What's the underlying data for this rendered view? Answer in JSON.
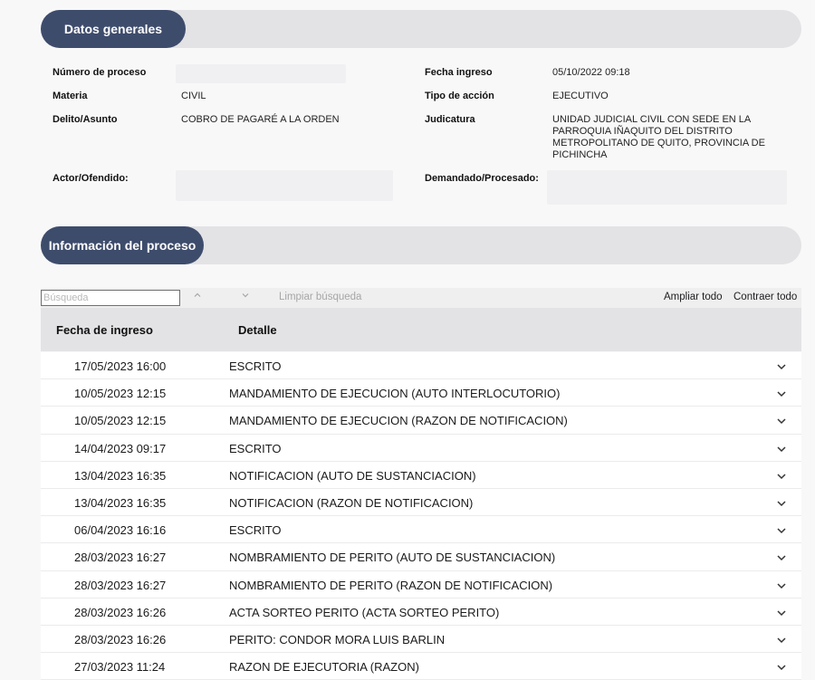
{
  "general": {
    "title": "Datos generales",
    "numero_proceso": {
      "label": "Número de proceso",
      "value": ""
    },
    "fecha_ingreso": {
      "label": "Fecha ingreso",
      "value": "05/10/2022 09:18"
    },
    "materia": {
      "label": "Materia",
      "value": "CIVIL"
    },
    "tipo_accion": {
      "label": "Tipo de acción",
      "value": "EJECUTIVO"
    },
    "delito": {
      "label": "Delito/Asunto",
      "value": "COBRO DE PAGARÉ A LA ORDEN"
    },
    "judicatura": {
      "label": "Judicatura",
      "value_lines": [
        "UNIDAD JUDICIAL CIVIL CON SEDE EN LA",
        "PARROQUIA IÑAQUITO DEL DISTRITO",
        "METROPOLITANO DE QUITO, PROVINCIA DE",
        "PICHINCHA"
      ]
    },
    "actor": {
      "label": "Actor/Ofendido:",
      "value": ""
    },
    "demandado": {
      "label": "Demandado/Procesado:",
      "value": ""
    }
  },
  "process": {
    "title": "Información del proceso",
    "search": {
      "placeholder": "Búsqueda",
      "value": ""
    },
    "toolbar": {
      "clear_label": "Limpiar búsqueda",
      "expand_all_label": "Ampliar todo",
      "collapse_all_label": "Contraer todo"
    },
    "columns": {
      "date": "Fecha de ingreso",
      "detail": "Detalle"
    },
    "rows": [
      {
        "date": "17/05/2023 16:00",
        "detail": "ESCRITO"
      },
      {
        "date": "10/05/2023 12:15",
        "detail": "MANDAMIENTO DE EJECUCION (AUTO INTERLOCUTORIO)"
      },
      {
        "date": "10/05/2023 12:15",
        "detail": "MANDAMIENTO DE EJECUCION (RAZON DE NOTIFICACION)"
      },
      {
        "date": "14/04/2023 09:17",
        "detail": "ESCRITO"
      },
      {
        "date": "13/04/2023 16:35",
        "detail": "NOTIFICACION (AUTO DE SUSTANCIACION)"
      },
      {
        "date": "13/04/2023 16:35",
        "detail": "NOTIFICACION (RAZON DE NOTIFICACION)"
      },
      {
        "date": "06/04/2023 16:16",
        "detail": "ESCRITO"
      },
      {
        "date": "28/03/2023 16:27",
        "detail": "NOMBRAMIENTO DE PERITO (AUTO DE SUSTANCIACION)"
      },
      {
        "date": "28/03/2023 16:27",
        "detail": "NOMBRAMIENTO DE PERITO (RAZON DE NOTIFICACION)"
      },
      {
        "date": "28/03/2023 16:26",
        "detail": "ACTA SORTEO PERITO (ACTA SORTEO PERITO)"
      },
      {
        "date": "28/03/2023 16:26",
        "detail": "PERITO: CONDOR MORA LUIS BARLIN"
      },
      {
        "date": "27/03/2023 11:24",
        "detail": "RAZON DE EJECUTORIA (RAZON)"
      }
    ]
  },
  "icons": {
    "up": "chevron-up-icon",
    "down": "chevron-down-icon",
    "expand": "chevron-down-icon"
  },
  "colors": {
    "pill": "#3e4c6c",
    "bar": "#e3e3e5",
    "background": "#f8f8f9"
  }
}
